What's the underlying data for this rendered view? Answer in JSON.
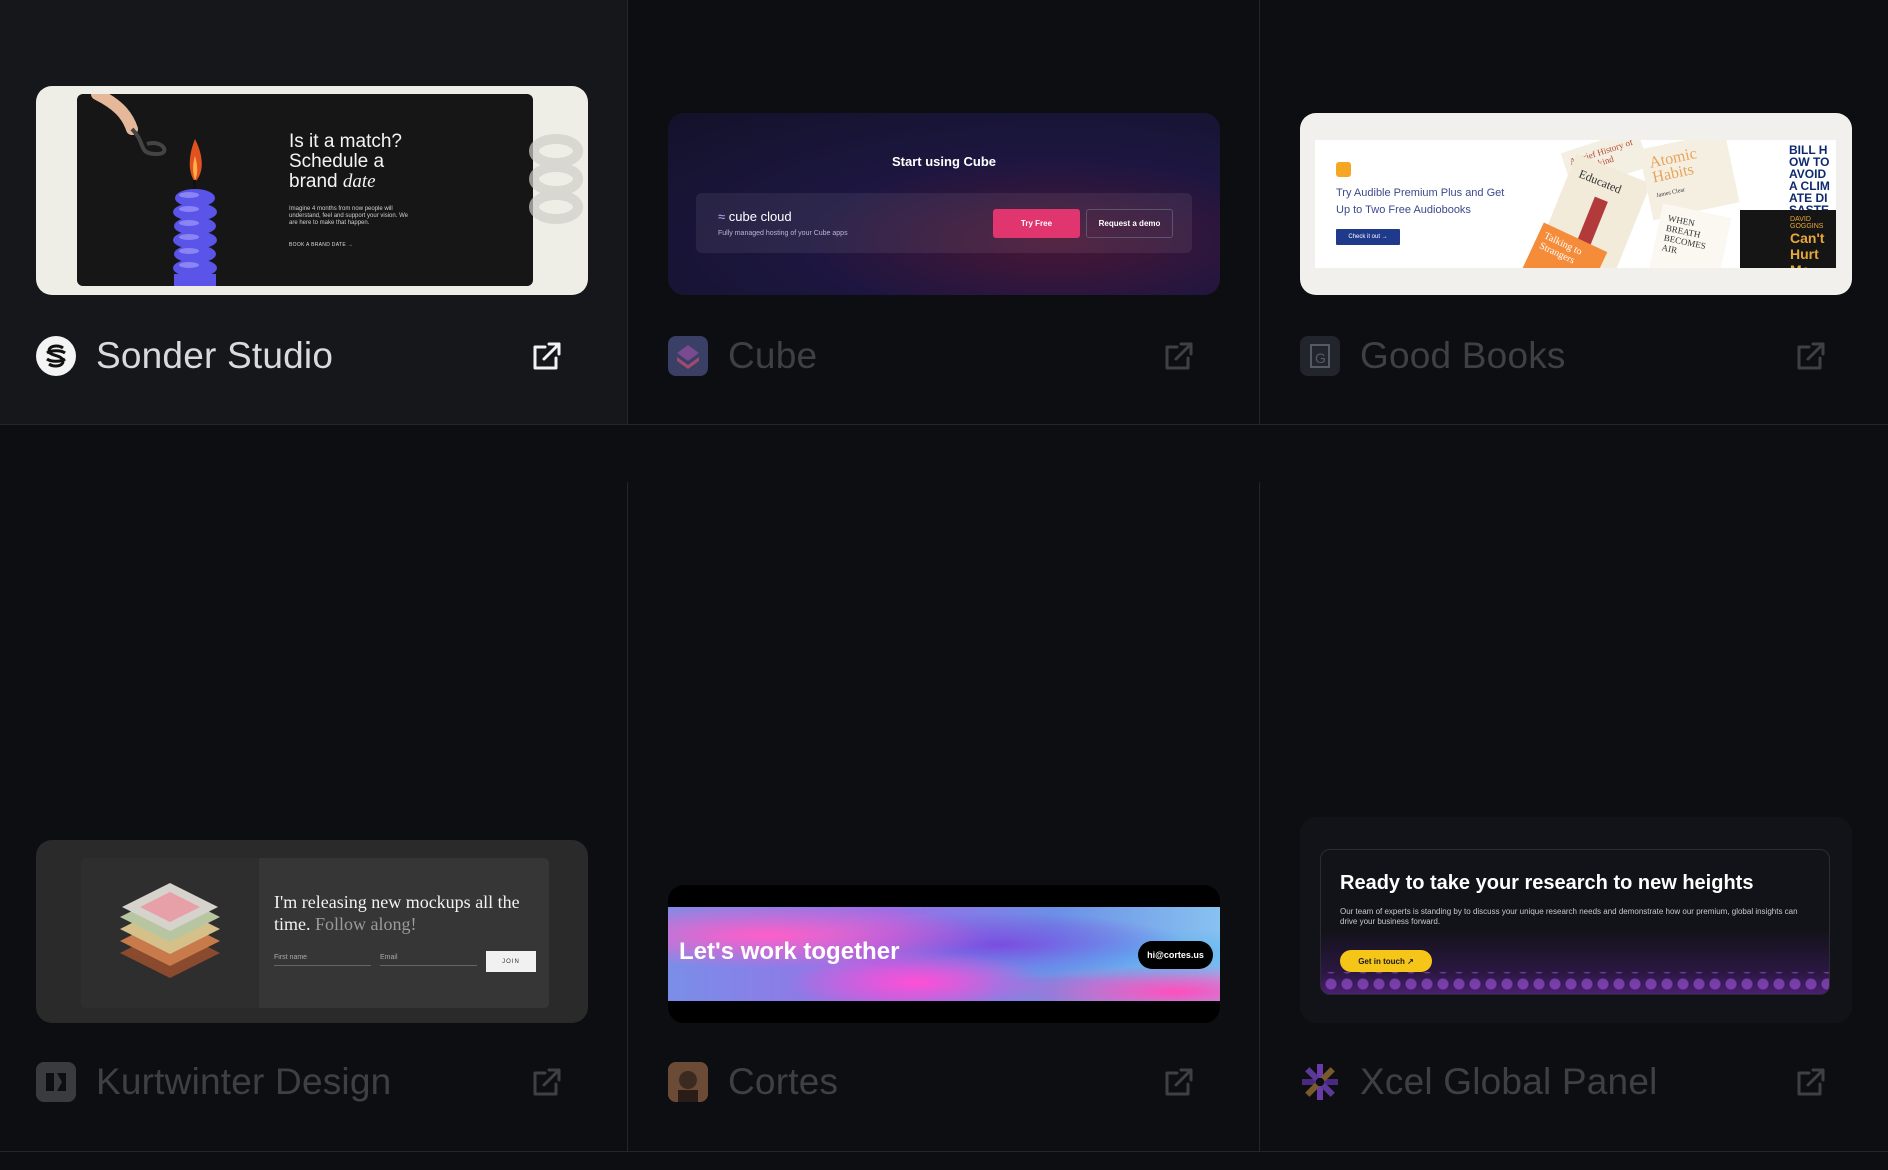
{
  "cards": [
    {
      "name": "Sonder Studio",
      "preview": {
        "headline_1": "Is it a match?",
        "headline_2": "Schedule a",
        "headline_3": "brand ",
        "headline_em": "date",
        "body": "Imagine 4 months from now people will understand, feel and support your vision. We are here to make that happen.",
        "cta": "BOOK A BRAND DATE →"
      }
    },
    {
      "name": "Cube",
      "preview": {
        "title": "Start using Cube",
        "logo_text": "cube cloud",
        "subtitle": "Fully managed hosting of your Cube apps",
        "primary_button": "Try Free",
        "secondary_button": "Request a demo"
      }
    },
    {
      "name": "Good Books",
      "preview": {
        "text": "Try Audible Premium Plus and Get Up to Two Free Audiobooks",
        "button": "Check it out →",
        "book_1": "Educated",
        "book_2": "Atomic Habits",
        "book_2_author": "James Clear",
        "book_3": "When Breath Becomes Air",
        "book_4": "Talking to Strangers",
        "book_5": "A Brief History of Humankind",
        "book_6": "Can't Hurt Me",
        "book_6_author": "DAVID GOGGINS",
        "book_7": "BILL HOW TO AVOID A CLIMATE DISASTER"
      }
    },
    {
      "name": "Kurtwinter Design",
      "preview": {
        "headline": "I'm releasing new mockups all the time. ",
        "headline_muted": "Follow along!",
        "first_name_placeholder": "First name",
        "email_placeholder": "Email",
        "button": "JOIN"
      }
    },
    {
      "name": "Cortes",
      "preview": {
        "headline": "Let's work together",
        "email": "hi@cortes.us"
      }
    },
    {
      "name": "Xcel Global Panel",
      "preview": {
        "title": "Ready to take your research to new heights",
        "body": "Our team of experts is standing by to discuss your unique research needs and demonstrate how our premium, global insights can drive your business forward.",
        "button": "Get in touch ↗"
      }
    }
  ],
  "icons": {
    "external_link": "external-link-icon"
  },
  "colors": {
    "page_bg": "#0d0e11",
    "active_card_bg": "#16171b",
    "muted_text": "#3e4046",
    "active_text": "#d9dade"
  }
}
